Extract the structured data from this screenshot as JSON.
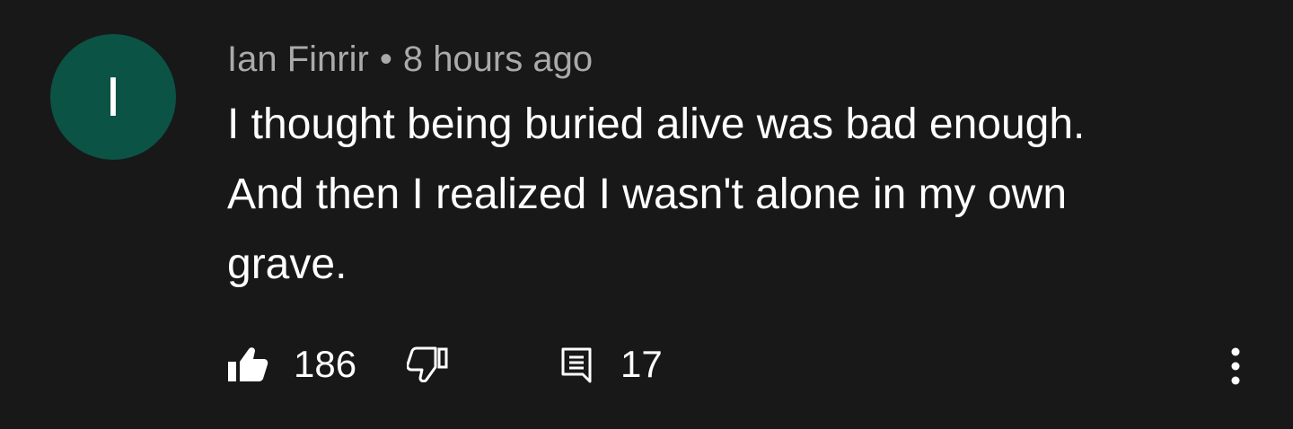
{
  "comment": {
    "avatar_letter": "I",
    "avatar_color": "#0b5345",
    "author": "Ian Finrir",
    "separator": "•",
    "timestamp": "8 hours ago",
    "text_lines": [
      "I thought being buried alive was bad enough.",
      "And then I realized I wasn't alone in my own",
      "grave."
    ]
  },
  "actions": {
    "like_icon": "thumbs-up-icon",
    "like_count": "186",
    "dislike_icon": "thumbs-down-icon",
    "reply_icon": "reply-comment-icon",
    "reply_count": "17",
    "more_icon": "more-vertical-icon"
  },
  "colors": {
    "background": "#181818",
    "text": "#ffffff",
    "meta_text": "#aaaaaa"
  }
}
